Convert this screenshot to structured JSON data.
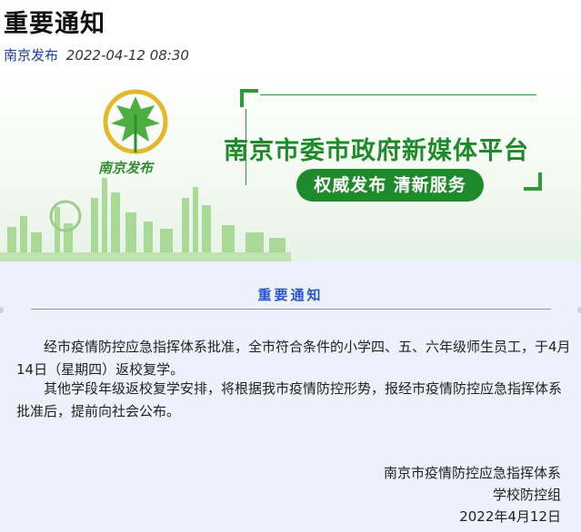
{
  "article": {
    "title": "重要通知",
    "source": "南京发布",
    "timestamp": "2022-04-12 08:30"
  },
  "banner": {
    "logo_text": "南京发布",
    "headline": "南京市委市政府新媒体平台",
    "slogan": "权威发布  清新服务",
    "colors": {
      "brand_green": "#1f8a2c",
      "leaf_gold": "#e3b92b"
    },
    "icons": [
      "maple-leaf-logo-icon",
      "city-skyline"
    ]
  },
  "notice": {
    "heading": "重要通知",
    "paragraphs": [
      "经市疫情防控应急指挥体系批准，全市符合条件的小学四、五、六年级师生员工，于4月14日（星期四）返校复学。",
      "其他学段年级返校复学安排，将根据我市疫情防控形势，报经市疫情防控应急指挥体系批准后，提前向社会公布。"
    ],
    "signature": {
      "org": "南京市疫情防控应急指挥体系",
      "dept": "学校防控组",
      "date": "2022年4月12日"
    },
    "colors": {
      "heading": "#2558c8",
      "background": "#eef1fb"
    }
  }
}
